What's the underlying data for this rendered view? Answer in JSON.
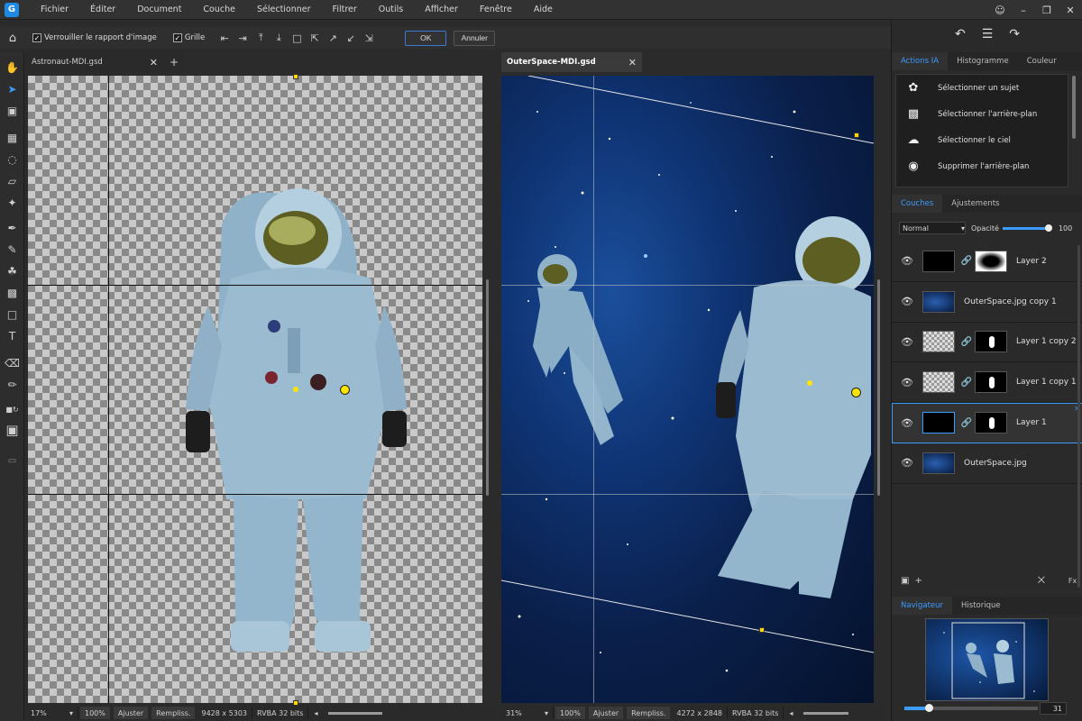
{
  "menu": [
    "Fichier",
    "Éditer",
    "Document",
    "Couche",
    "Sélectionner",
    "Filtrer",
    "Outils",
    "Afficher",
    "Fenêtre",
    "Aide"
  ],
  "options": {
    "lock_ratio_label": "Verrouiller le rapport d'image",
    "grid_label": "Grille",
    "ok_label": "OK",
    "cancel_label": "Annuler"
  },
  "docs": {
    "left": {
      "tab_title": "Astronaut-MDI.gsd",
      "zoom": "17%",
      "zoom_100": "100%",
      "fit": "Ajuster",
      "fill": "Rempliss.",
      "size": "9428 x 5303",
      "mode": "RVBA 32 bits"
    },
    "right": {
      "tab_title": "OuterSpace-MDI.gsd",
      "zoom": "31%",
      "zoom_100": "100%",
      "fit": "Ajuster",
      "fill": "Rempliss.",
      "size": "4272 x 2848",
      "mode": "RVBA 32 bits"
    }
  },
  "panel": {
    "top_tabs": [
      "Actions IA",
      "Histogramme",
      "Couleur"
    ],
    "ai_actions": [
      {
        "label": "Sélectionner un sujet",
        "icon": "flower-icon"
      },
      {
        "label": "Sélectionner l'arrière-plan",
        "icon": "background-icon"
      },
      {
        "label": "Sélectionner le ciel",
        "icon": "sky-icon"
      },
      {
        "label": "Supprimer l'arrière-plan",
        "icon": "remove-background-icon"
      }
    ],
    "layer_tabs": [
      "Couches",
      "Ajustements"
    ],
    "blend_mode": "Normal",
    "opacity_label": "Opacité",
    "opacity_value": "100",
    "layers": [
      {
        "name": "Layer 2",
        "thumb": "black",
        "mask": "mask-glow"
      },
      {
        "name": "OuterSpace.jpg copy 1",
        "thumb": "space",
        "mask": ""
      },
      {
        "name": "Layer 1 copy 2",
        "thumb": "check",
        "mask": "mask-fig"
      },
      {
        "name": "Layer 1 copy 1",
        "thumb": "check",
        "mask": "mask-fig"
      },
      {
        "name": "Layer 1",
        "thumb": "black",
        "mask": "mask-fig",
        "selected": true
      },
      {
        "name": "OuterSpace.jpg",
        "thumb": "space",
        "mask": ""
      }
    ],
    "nav_tabs": [
      "Navigateur",
      "Historique"
    ],
    "nav_zoom": "31"
  },
  "colors": {
    "accent": "#3c9bff",
    "handle": "#ffd800"
  }
}
